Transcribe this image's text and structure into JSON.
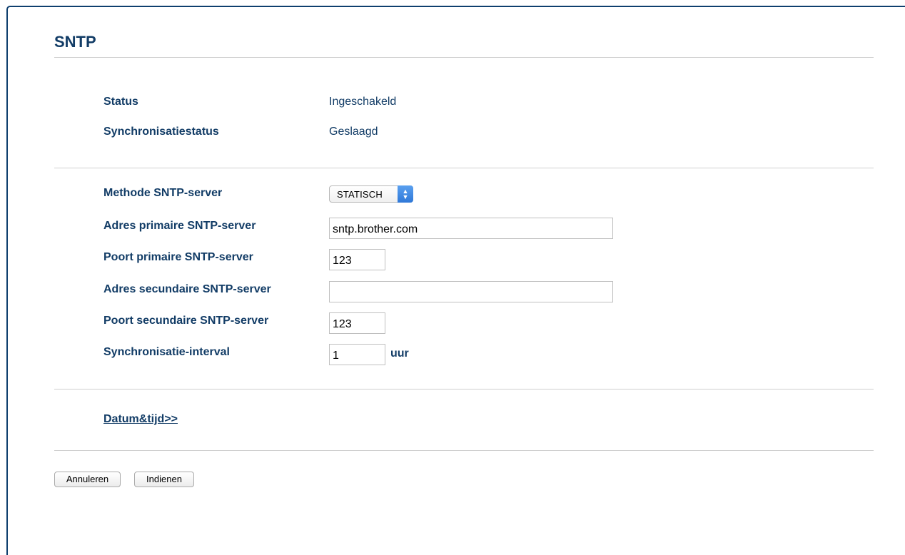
{
  "page": {
    "title": "SNTP"
  },
  "status_section": {
    "status_label": "Status",
    "status_value": "Ingeschakeld",
    "sync_status_label": "Synchronisatiestatus",
    "sync_status_value": "Geslaagd"
  },
  "settings": {
    "method_label": "Methode SNTP-server",
    "method_value": "STATISCH",
    "primary_address_label": "Adres primaire SNTP-server",
    "primary_address_value": "sntp.brother.com",
    "primary_port_label": "Poort primaire SNTP-server",
    "primary_port_value": "123",
    "secondary_address_label": "Adres secundaire SNTP-server",
    "secondary_address_value": "",
    "secondary_port_label": "Poort secundaire SNTP-server",
    "secondary_port_value": "123",
    "interval_label": "Synchronisatie-interval",
    "interval_value": "1",
    "interval_unit": "uur"
  },
  "links": {
    "date_time": "Datum&tijd>>"
  },
  "buttons": {
    "cancel": "Annuleren",
    "submit": "Indienen"
  },
  "colors": {
    "heading": "#123c66",
    "frame_border": "#0f3f6e",
    "select_accent": "#2f78d8"
  }
}
